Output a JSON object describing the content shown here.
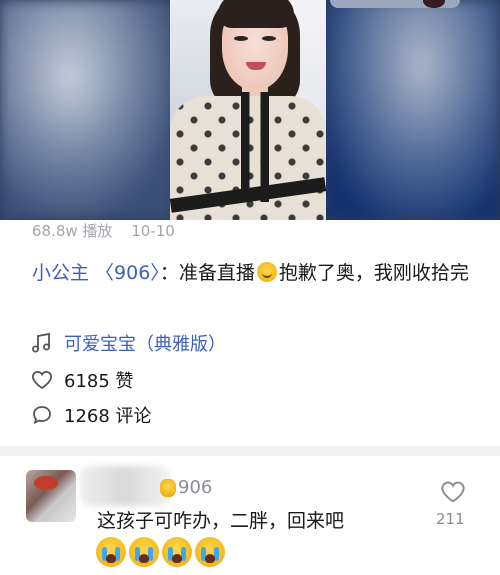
{
  "video": {
    "plays": "68.8w 播放",
    "date": "10-10"
  },
  "post": {
    "author": "小公主 〈906〉",
    "separator": "：",
    "text_before_emoji": "准备直播",
    "text_after_emoji": "抱歉了奥，我刚收拾完"
  },
  "music": {
    "title": "可爱宝宝（典雅版）",
    "icon": "music-note-icon"
  },
  "stats": {
    "likes": "6185 赞",
    "comments": "1268 评论",
    "like_icon": "heart-outline-icon",
    "comment_icon": "comment-bubble-icon"
  },
  "comment": {
    "name": "906",
    "text": "这孩子可咋办，二胖，回来吧",
    "emoji": "crying-face-emoji",
    "emoji_count": 4,
    "like_count": "211",
    "like_icon": "heart-outline-icon"
  },
  "colors": {
    "link": "#3d60b8",
    "meta": "#a3a6ab",
    "divider": "#f3f3f5"
  }
}
